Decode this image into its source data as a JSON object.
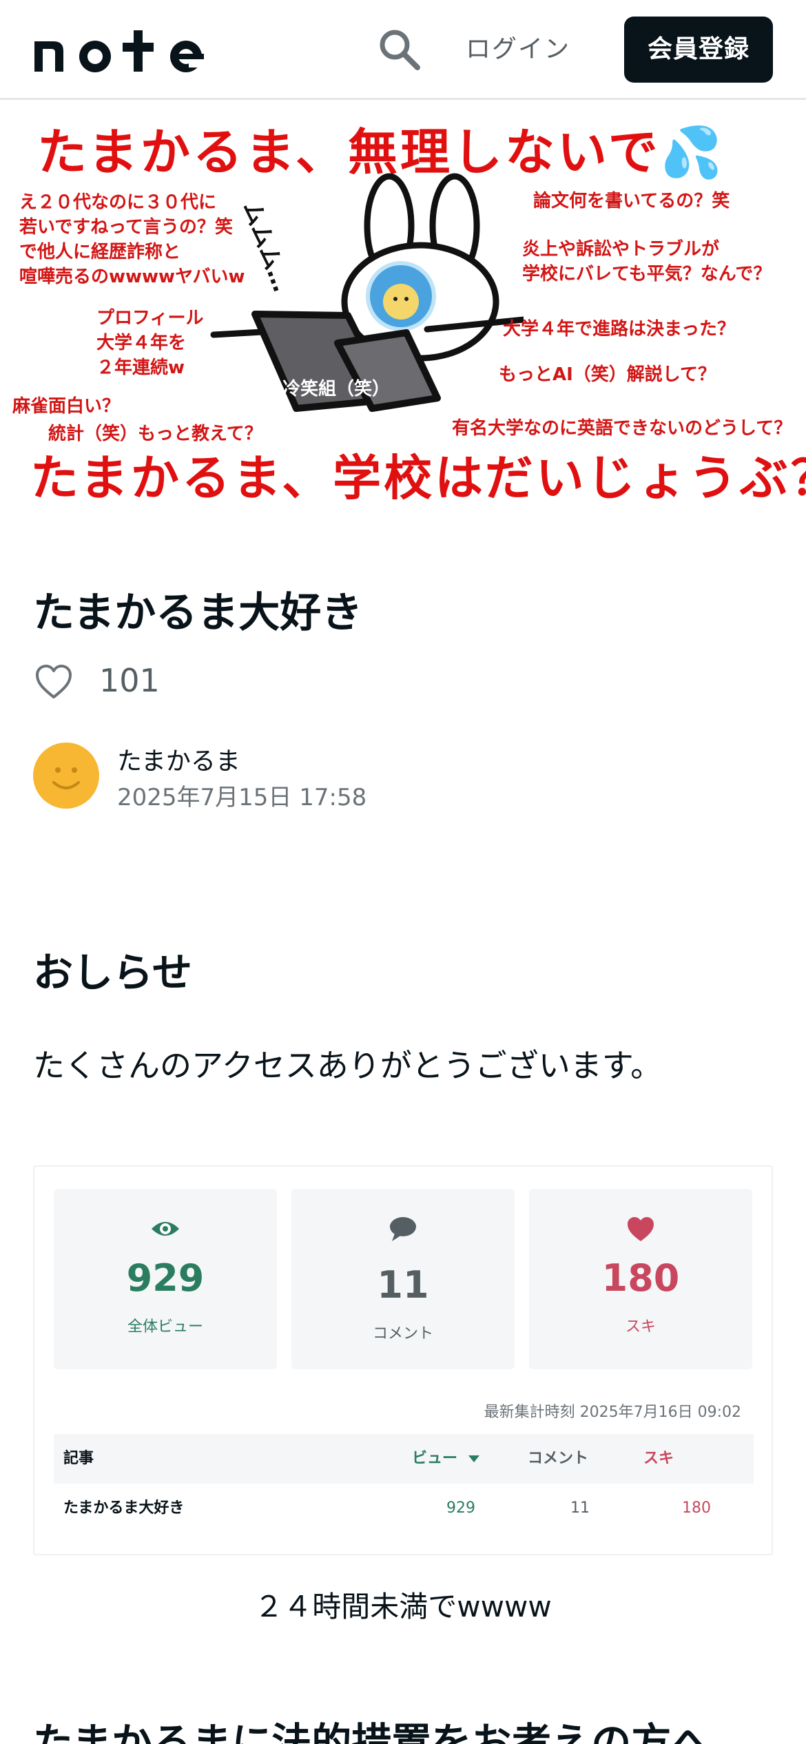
{
  "header": {
    "logo_text": "note",
    "login_label": "ログイン",
    "signup_label": "会員登録"
  },
  "hero": {
    "headline_top": "たまかるま、無理しないで💦",
    "headline_bottom": "たまかるま、学校はだいじょうぶ？",
    "laptop_label": "冷笑組（笑）",
    "sound_effect": "ムムム…",
    "questions": [
      "え２０代なのに３０代に\n若いですねって言うの？笑\nで他人に経歴詐称と\n喧嘩売るのwwwwヤバいw",
      "プロフィール\n大学４年を\n２年連続w",
      "麻雀面白い？",
      "統計（笑）もっと教えて？",
      "論文何を書いてるの？笑",
      "炎上や訴訟やトラブルが\n学校にバレても平気？なんで？",
      "大学４年で進路は決まった？",
      "もっとAI（笑）解説して？",
      "有名大学なのに英語できないのどうして？"
    ]
  },
  "article": {
    "title": "たまかるま大好き",
    "like_count": "101",
    "author": "たまかるま",
    "date": "2025年7月15日 17:58",
    "section_heading": "おしらせ",
    "paragraph": "たくさんのアクセスありがとうございます。",
    "after_stats": "２４時間未満でwwww",
    "next_heading": "たまかるまに法的措置をお考えの方へ"
  },
  "stats": {
    "views": {
      "value": "929",
      "label": "全体ビュー"
    },
    "comments": {
      "value": "11",
      "label": "コメント"
    },
    "likes": {
      "value": "180",
      "label": "スキ"
    },
    "updated": "最新集計時刻 2025年7月16日 09:02",
    "table": {
      "headers": {
        "article": "記事",
        "views": "ビュー",
        "comments": "コメント",
        "likes": "スキ"
      },
      "rows": [
        {
          "article": "たまかるま大好き",
          "views": "929",
          "comments": "11",
          "likes": "180"
        }
      ]
    }
  },
  "colors": {
    "brand_dark": "#08131a",
    "hero_red": "#e01010",
    "view_green": "#2a7d5f",
    "comment_gray": "#555e63",
    "like_red": "#c8475e",
    "avatar_yellow": "#f7b733"
  },
  "icons": [
    "search-icon",
    "heart-outline-icon",
    "eye-icon",
    "speech-bubble-icon",
    "heart-filled-icon",
    "sort-down-icon"
  ]
}
